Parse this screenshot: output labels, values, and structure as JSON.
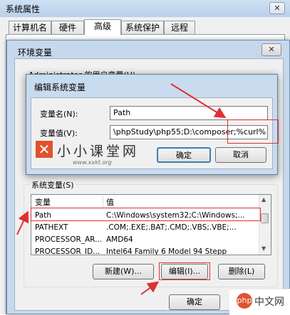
{
  "outer_window": {
    "title": "系统属性",
    "close_glyph": "✕",
    "tabs": [
      {
        "label": "计算机名"
      },
      {
        "label": "硬件"
      },
      {
        "label": "高级"
      },
      {
        "label": "系统保护"
      },
      {
        "label": "远程"
      }
    ]
  },
  "env_window": {
    "title": "环境变量",
    "close_glyph": "✕",
    "user_group_label": "Administrator 的用户变量(U)",
    "system_group_label": "系统变量(S)",
    "columns": {
      "name": "变量",
      "value": "值"
    },
    "system_vars": [
      {
        "name": "Path",
        "value": "C:\\Windows\\system32;C:\\Windows;..."
      },
      {
        "name": "PATHEXT",
        "value": ".COM;.EXE;.BAT;.CMD;.VBS;.VBE;..."
      },
      {
        "name": "PROCESSOR_AR...",
        "value": "AMD64"
      },
      {
        "name": "PROCESSOR_ID...",
        "value": "Intel64 Family 6 Model 94 Stepp"
      }
    ],
    "buttons": {
      "new": "新建(W)...",
      "edit": "编辑(I)...",
      "delete": "删除(L)"
    },
    "footer": {
      "ok": "确定"
    }
  },
  "edit_dialog": {
    "title": "编辑系统变量",
    "name_label": "变量名(N):",
    "value_label": "变量值(V):",
    "name_value": "Path",
    "value_value": "\\phpStudy\\php55;D:\\composer;%curl%",
    "ok_label": "确定",
    "cancel_label": "取消"
  },
  "watermark": {
    "logo_glyph": "✕",
    "text": "小小课堂网",
    "url": "www.xxkt.org"
  },
  "bottom_watermark": {
    "badge": "php",
    "text": "中文网"
  },
  "colors": {
    "annotation_red": "#e03030",
    "brand_orange": "#e0522d",
    "dialog_frame": "#c9dbee"
  }
}
